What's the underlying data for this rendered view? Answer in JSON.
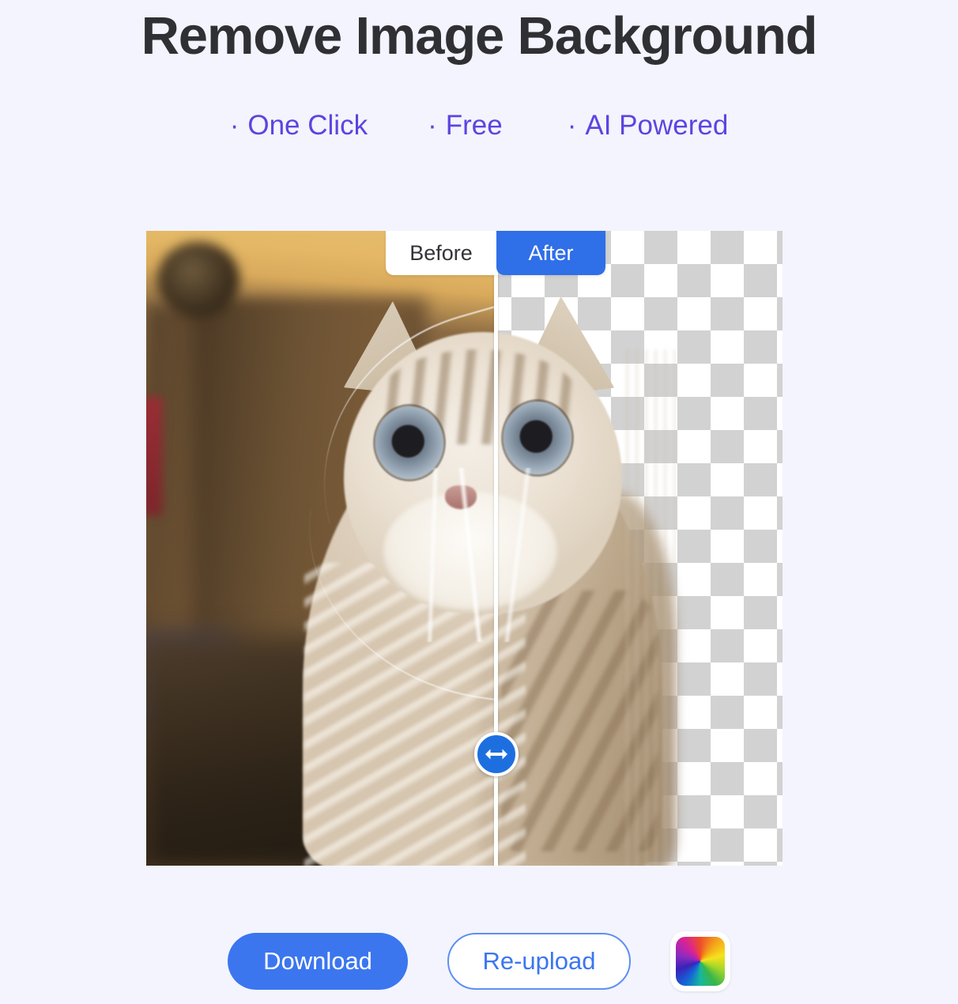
{
  "header": {
    "title": "Remove Image Background",
    "features": [
      {
        "bullet": "·",
        "label": "One Click"
      },
      {
        "bullet": "·",
        "label": "Free"
      },
      {
        "bullet": "·",
        "label": "AI Powered"
      }
    ],
    "feature_color": "#5b45e0",
    "title_color": "#303034"
  },
  "viewer": {
    "toggle": {
      "before_label": "Before",
      "after_label": "After",
      "active": "After",
      "active_bg": "#2f6fe8",
      "inactive_bg": "#ffffff"
    },
    "handle": {
      "icon": "left-right-arrow-icon",
      "color": "#1d6fe0",
      "position_percent": 55
    },
    "before_image_alt": "Fluffy cream-colored cat sitting in a blurred room with wooden cabinet",
    "after_image_alt": "Same cat with background removed, shown over transparency checkerboard",
    "checker_color": "#d2d2d2"
  },
  "actions": {
    "download_label": "Download",
    "reupload_label": "Re-upload",
    "color_picker_icon": "color-wheel-icon",
    "download_bg": "#3b76ef",
    "reupload_border": "#5f8ff2"
  },
  "page": {
    "background": "#f3f4fd"
  }
}
